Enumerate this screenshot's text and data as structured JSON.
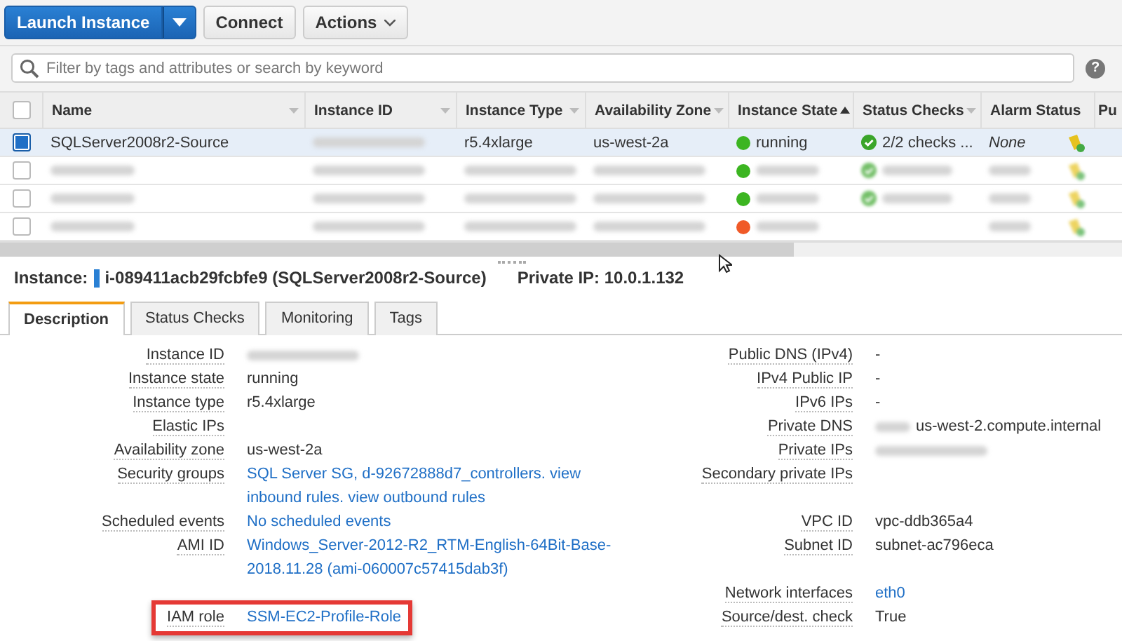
{
  "toolbar": {
    "launch_button": "Launch Instance",
    "connect_button": "Connect",
    "actions_button": "Actions"
  },
  "search": {
    "placeholder": "Filter by tags and attributes or search by keyword",
    "help": "?"
  },
  "table": {
    "select_all": {
      "checked": false
    },
    "columns": [
      {
        "label": "Name",
        "menu": true
      },
      {
        "label": "Instance ID",
        "menu": true
      },
      {
        "label": "Instance Type",
        "menu": true
      },
      {
        "label": "Availability Zone",
        "menu": true
      },
      {
        "label": "Instance State",
        "menu": false,
        "sorted_ascending": true
      },
      {
        "label": "Status Checks",
        "menu": true
      },
      {
        "label": "Alarm Status",
        "menu": false
      },
      {
        "label": "Pu",
        "menu": false
      }
    ],
    "rows": [
      {
        "selected": true,
        "name": "SQLServer2008r2-Source",
        "type": "r5.4xlarge",
        "zone": "us-west-2a",
        "state": "running",
        "color": "#3cb521",
        "checks": "2/2 checks ...",
        "checks_ok": true,
        "alarm": "None"
      },
      {
        "selected": false,
        "color": "#3cb521",
        "checks_ok": true
      },
      {
        "selected": false,
        "color": "#3cb521",
        "checks_ok": true
      },
      {
        "selected": false,
        "color": "#f05a28",
        "checks_ok": false
      }
    ]
  },
  "instance_line": {
    "label": "Instance:",
    "id": "i-089411acb29fcbfe9 (SQLServer2008r2-Source)",
    "ip": "Private IP: 10.0.1.132"
  },
  "tabs": [
    {
      "label": "Description",
      "selected": true
    },
    {
      "label": "Status Checks",
      "selected": false
    },
    {
      "label": "Monitoring",
      "selected": false
    },
    {
      "label": "Tags",
      "selected": false
    }
  ],
  "details_left": [
    {
      "label": "Instance ID",
      "kind": "blurred"
    },
    {
      "label": "Instance state",
      "kind": "text",
      "value": [
        "running"
      ]
    },
    {
      "label": "Instance type",
      "kind": "text",
      "value": [
        "r5.4xlarge"
      ]
    },
    {
      "label": "Elastic IPs",
      "kind": "text"
    },
    {
      "label": "Availability zone",
      "kind": "text",
      "value": [
        "us-west-2a"
      ]
    },
    {
      "label": "Security groups",
      "kind": "link",
      "value": [
        "SQL Server SG, d-92672888d7_controllers. view",
        "inbound rules. view outbound rules"
      ]
    },
    {
      "label": "Scheduled events",
      "kind": "link",
      "value": [
        "No scheduled events"
      ]
    },
    {
      "label": "AMI ID",
      "kind": "link",
      "value": [
        "Windows_Server-2012-R2_RTM-English-64Bit-Base-",
        "2018.11.28 (ami-060007c57415dab3f)"
      ]
    },
    {
      "label": "IAM role",
      "kind": "link",
      "value": [
        "SSM-EC2-Profile-Role"
      ],
      "highlighted": true,
      "gap_before": true
    }
  ],
  "details_right": [
    {
      "label": "Public DNS (IPv4)",
      "kind": "text",
      "value": [
        "-"
      ]
    },
    {
      "label": "IPv4 Public IP",
      "kind": "text",
      "value": [
        "-"
      ]
    },
    {
      "label": "IPv6 IPs",
      "kind": "text",
      "value": [
        "-"
      ]
    },
    {
      "label": "Private DNS",
      "kind": "partly_blurred",
      "value": [
        "us-west-2.compute.internal"
      ]
    },
    {
      "label": "Private IPs",
      "kind": "blurred"
    },
    {
      "label": "Secondary private IPs",
      "kind": "text"
    },
    {
      "label": "VPC ID",
      "kind": "text",
      "value": [
        "vpc-ddb365a4"
      ],
      "gap_before": true
    },
    {
      "label": "Subnet ID",
      "kind": "text",
      "value": [
        "subnet-ac796eca"
      ]
    },
    {
      "label": "Network interfaces",
      "kind": "link",
      "value": [
        "eth0"
      ],
      "gap_before": true
    },
    {
      "label": "Source/dest. check",
      "kind": "text",
      "value": [
        "True"
      ]
    }
  ]
}
